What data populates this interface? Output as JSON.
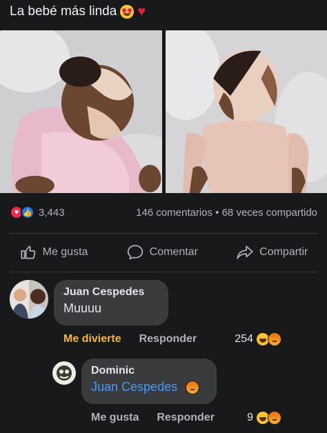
{
  "post": {
    "text": "La bebé más linda",
    "emojis": [
      "heart-eyes-emoji",
      "red-heart-emoji"
    ]
  },
  "stats": {
    "reactions_count": "3,443",
    "comments_shares": "146 comentarios • 68 veces compartido",
    "reaction_icons": [
      "love-icon",
      "like-icon"
    ]
  },
  "actions": {
    "like": "Me gusta",
    "comment": "Comentar",
    "share": "Compartir"
  },
  "comments": [
    {
      "author": "Juan Cespedes",
      "text": "Muuuu",
      "reaction_label": "Me divierte",
      "reply_label": "Responder",
      "reaction_count": "254",
      "reaction_icons": [
        "haha-icon",
        "angry-icon"
      ]
    },
    {
      "author": "Dominic",
      "text": "Juan Cespedes",
      "text_emoji": "angry-emoji",
      "like_label": "Me gusta",
      "reply_label": "Responder",
      "reaction_count": "9",
      "reaction_icons": [
        "haha-icon",
        "angry-icon"
      ]
    }
  ],
  "colors": {
    "background": "#18191a",
    "bubble": "#3a3b3c",
    "mention": "#4599ff",
    "haha_label": "#f7b928",
    "secondary_text": "#b0b3b8"
  }
}
